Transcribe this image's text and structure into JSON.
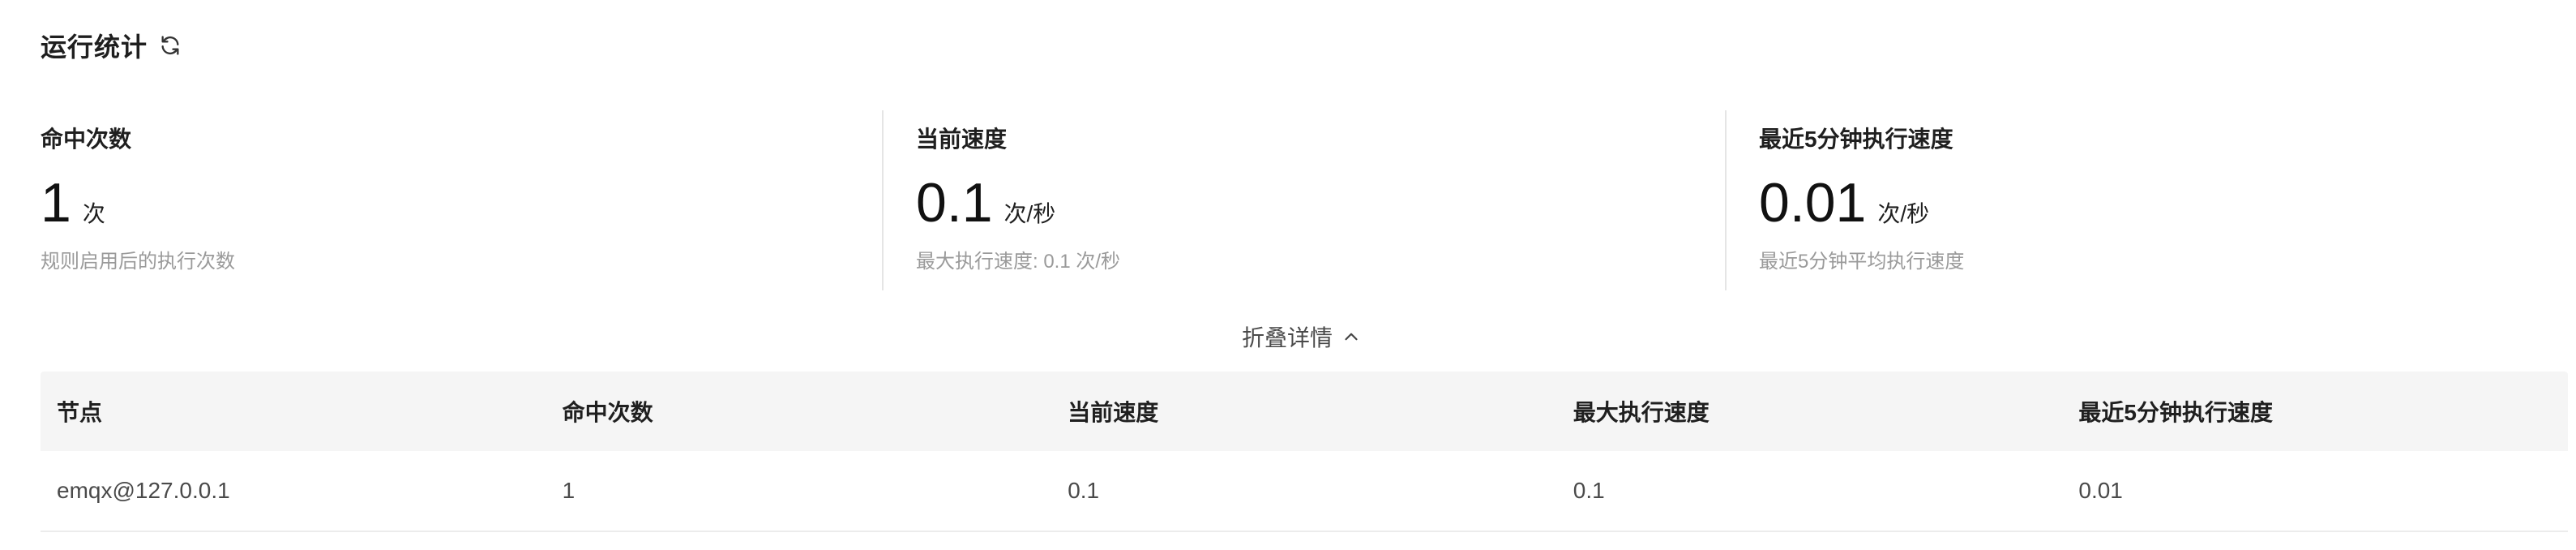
{
  "header": {
    "title": "运行统计",
    "refresh_icon": "refresh-icon"
  },
  "stats": [
    {
      "title": "命中次数",
      "value": "1",
      "unit": "次",
      "description": "规则启用后的执行次数"
    },
    {
      "title": "当前速度",
      "value": "0.1",
      "unit": "次/秒",
      "description": "最大执行速度: 0.1 次/秒"
    },
    {
      "title": "最近5分钟执行速度",
      "value": "0.01",
      "unit": "次/秒",
      "description": "最近5分钟平均执行速度"
    }
  ],
  "collapse": {
    "label": "折叠详情",
    "icon": "chevron-up-icon"
  },
  "table": {
    "columns": [
      "节点",
      "命中次数",
      "当前速度",
      "最大执行速度",
      "最近5分钟执行速度"
    ],
    "rows": [
      [
        "emqx@127.0.0.1",
        "1",
        "0.1",
        "0.1",
        "0.01"
      ]
    ]
  }
}
